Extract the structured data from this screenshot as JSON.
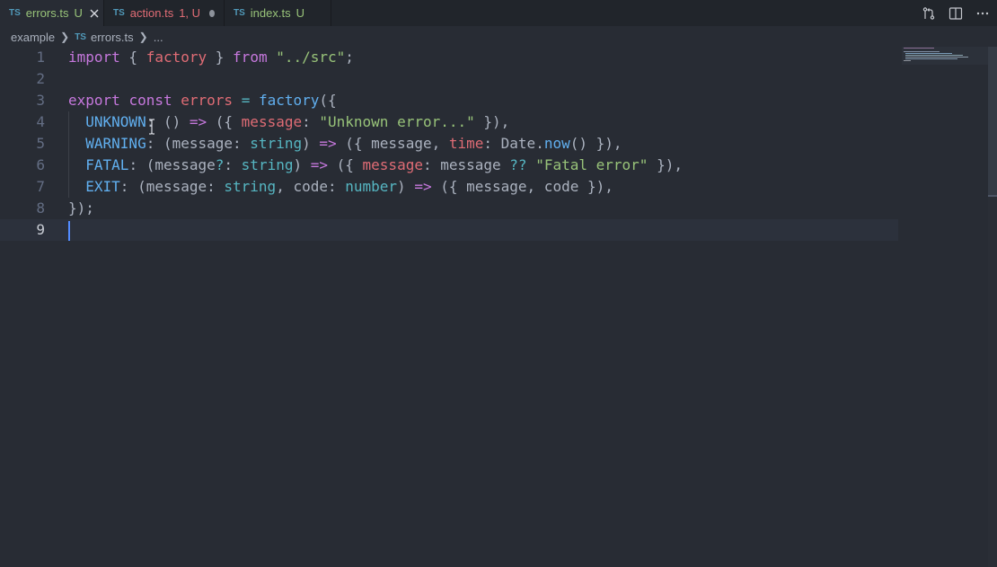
{
  "tabs": [
    {
      "lang": "TS",
      "name": "errors.ts",
      "status": "U",
      "name_color": "#98c379",
      "status_color": "#98c379",
      "active": true,
      "action": "close"
    },
    {
      "lang": "TS",
      "name": "action.ts",
      "status": "1, U",
      "name_color": "#e06c75",
      "status_color": "#e06c75",
      "active": false,
      "action": "dirty"
    },
    {
      "lang": "TS",
      "name": "index.ts",
      "status": "U",
      "name_color": "#98c379",
      "status_color": "#98c379",
      "active": false,
      "action": "none"
    }
  ],
  "tab_actions": {
    "icons": [
      "source-control-compare-icon",
      "split-editor-icon",
      "more-actions-icon"
    ]
  },
  "breadcrumb": {
    "folder": "example",
    "lang": "TS",
    "file": "errors.ts",
    "more": "..."
  },
  "editor": {
    "current_line": 9,
    "lines": [
      {
        "n": "1",
        "tokens": [
          [
            "kw",
            "import"
          ],
          [
            "pl",
            " { "
          ],
          [
            "var",
            "factory"
          ],
          [
            "pl",
            " } "
          ],
          [
            "kw",
            "from"
          ],
          [
            "pl",
            " "
          ],
          [
            "str",
            "\"../src\""
          ],
          [
            "pl",
            ";"
          ]
        ]
      },
      {
        "n": "2",
        "tokens": []
      },
      {
        "n": "3",
        "tokens": [
          [
            "kw",
            "export"
          ],
          [
            "pl",
            " "
          ],
          [
            "kw",
            "const"
          ],
          [
            "pl",
            " "
          ],
          [
            "var",
            "errors"
          ],
          [
            "pl",
            " "
          ],
          [
            "op",
            "="
          ],
          [
            "pl",
            " "
          ],
          [
            "fn",
            "factory"
          ],
          [
            "pl",
            "({"
          ]
        ]
      },
      {
        "n": "4",
        "tokens": [
          [
            "pl",
            "  "
          ],
          [
            "prop",
            "UNKNOWN"
          ],
          [
            "pl",
            ": () "
          ],
          [
            "kw",
            "=>"
          ],
          [
            "pl",
            " ({ "
          ],
          [
            "var",
            "message"
          ],
          [
            "pl",
            ": "
          ],
          [
            "str",
            "\"Unknown error...\""
          ],
          [
            "pl",
            " }),"
          ]
        ]
      },
      {
        "n": "5",
        "tokens": [
          [
            "pl",
            "  "
          ],
          [
            "prop",
            "WARNING"
          ],
          [
            "pl",
            ": (message: "
          ],
          [
            "typ",
            "string"
          ],
          [
            "pl",
            ") "
          ],
          [
            "kw",
            "=>"
          ],
          [
            "pl",
            " ({ message, "
          ],
          [
            "var",
            "time"
          ],
          [
            "pl",
            ": Date."
          ],
          [
            "fn",
            "now"
          ],
          [
            "pl",
            "() }),"
          ]
        ]
      },
      {
        "n": "6",
        "tokens": [
          [
            "pl",
            "  "
          ],
          [
            "prop",
            "FATAL"
          ],
          [
            "pl",
            ": (message"
          ],
          [
            "op",
            "?"
          ],
          [
            "pl",
            ": "
          ],
          [
            "typ",
            "string"
          ],
          [
            "pl",
            ") "
          ],
          [
            "kw",
            "=>"
          ],
          [
            "pl",
            " ({ "
          ],
          [
            "var",
            "message"
          ],
          [
            "pl",
            ": message "
          ],
          [
            "op",
            "??"
          ],
          [
            "pl",
            " "
          ],
          [
            "str",
            "\"Fatal error\""
          ],
          [
            "pl",
            " }),"
          ]
        ]
      },
      {
        "n": "7",
        "tokens": [
          [
            "pl",
            "  "
          ],
          [
            "prop",
            "EXIT"
          ],
          [
            "pl",
            ": (message: "
          ],
          [
            "typ",
            "string"
          ],
          [
            "pl",
            ", code: "
          ],
          [
            "typ",
            "number"
          ],
          [
            "pl",
            ") "
          ],
          [
            "kw",
            "=>"
          ],
          [
            "pl",
            " ({ message, code }),"
          ]
        ]
      },
      {
        "n": "8",
        "tokens": [
          [
            "pl",
            "});"
          ]
        ]
      },
      {
        "n": "9",
        "tokens": []
      }
    ]
  }
}
